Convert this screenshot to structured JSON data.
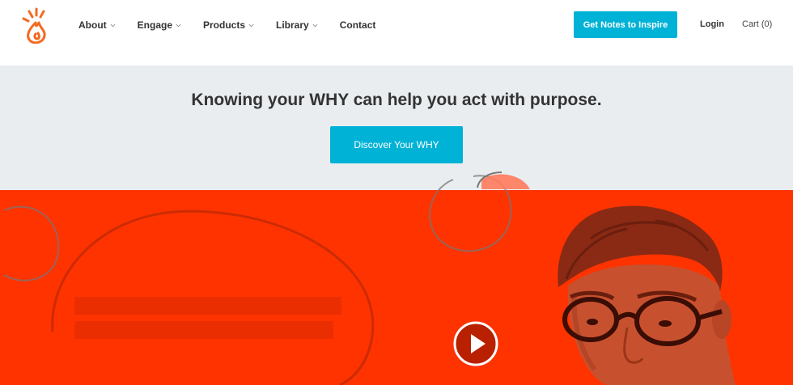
{
  "nav": {
    "items": [
      {
        "label": "About",
        "has_dropdown": true
      },
      {
        "label": "Engage",
        "has_dropdown": true
      },
      {
        "label": "Products",
        "has_dropdown": true
      },
      {
        "label": "Library",
        "has_dropdown": true
      },
      {
        "label": "Contact",
        "has_dropdown": false
      }
    ]
  },
  "header": {
    "logo_icon": "flame-logo-icon",
    "cta_label": "Get Notes to Inspire",
    "login_label": "Login",
    "cart_label": "Cart (0)"
  },
  "hero": {
    "title": "Knowing your WHY can help you act with purpose.",
    "button_label": "Discover Your WHY"
  },
  "video": {
    "play_icon": "play-icon"
  },
  "colors": {
    "accent": "#00b2d6",
    "hero_bg": "#e9edf0",
    "video_bg": "#ff3300",
    "logo": "#f26a21"
  }
}
